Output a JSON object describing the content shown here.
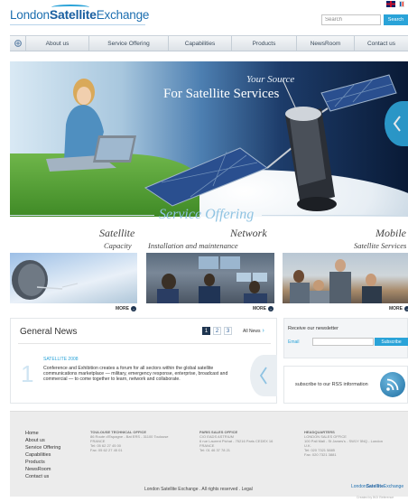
{
  "header": {
    "logo": {
      "part1": "London",
      "part2": "Satellite",
      "part3": "Exchange"
    },
    "search": {
      "placeholder": "Search",
      "button": "Search"
    }
  },
  "nav": {
    "items": [
      "About us",
      "Service Offering",
      "Capabilities",
      "Products",
      "NewsRoom",
      "Contact us"
    ]
  },
  "hero": {
    "tagline_1": "Your Source",
    "tagline_2": "For Satellite Services"
  },
  "services": {
    "heading": "Service Offering",
    "items": [
      {
        "title": "Satellite",
        "subtitle": "Capacity",
        "more": "MORE"
      },
      {
        "title": "Network",
        "subtitle": "Installation and maintenance",
        "more": "MORE"
      },
      {
        "title": "Mobile",
        "subtitle": "Satellite Services",
        "more": "MORE"
      }
    ]
  },
  "news": {
    "title": "General News",
    "pages": [
      "1",
      "2",
      "3"
    ],
    "all_news": "All News",
    "item": {
      "number": "1",
      "date": "SATELLITE 2008",
      "body": "Conference and Exhibition creates a forum for all sectors within the global satellite communications marketplace — military, emergency response, enterprise, broadcast and commercial — to come together to learn, network and collaborate."
    }
  },
  "newsletter": {
    "title": "Receive our newsletter",
    "email_label": "Email",
    "button": "Subscribe"
  },
  "rss": {
    "label": "subscribe to our RSS information"
  },
  "footer": {
    "nav": [
      "Home",
      "About us",
      "Service Offering",
      "Capabilities",
      "Products",
      "NewsRoom",
      "Contact us"
    ],
    "offices": [
      {
        "name": "TOULOUSE TECHNICAL OFFICE",
        "lines": [
          "86 Route d'Espagne - Bat ERS - 31100 Toulouse",
          "FRANCE",
          "Tel: 05 62 27 45 00",
          "Fax: 05 62 27 45 01"
        ]
      },
      {
        "name": "PARIS SALES OFFICE",
        "lines": [
          "C/O EADS ASTRIUM",
          "6 rue Laurent Pichat - 75216 Paris CEDEX 16",
          "FRANCE",
          "Tel: 01 46 37 78 21"
        ]
      },
      {
        "name": "HEADQUARTERS",
        "lines": [
          "LONDON SALES OFFICE",
          "100 Pall Mall - St James's - SW1Y 5NQ - London",
          "U.K.",
          "Tel: 020 7321 5885",
          "Fax: 020 7321 3881"
        ]
      }
    ],
    "copyright": "London Satellite Exchange . All rights reserved . Legal",
    "logo": {
      "part1": "London",
      "part2": "Satellite",
      "part3": "Exchange"
    }
  },
  "credit": "Created by BGI Reference",
  "colors": {
    "accent": "#2aa3d8",
    "brand": "#1d6fb0",
    "dark": "#1f3550"
  }
}
